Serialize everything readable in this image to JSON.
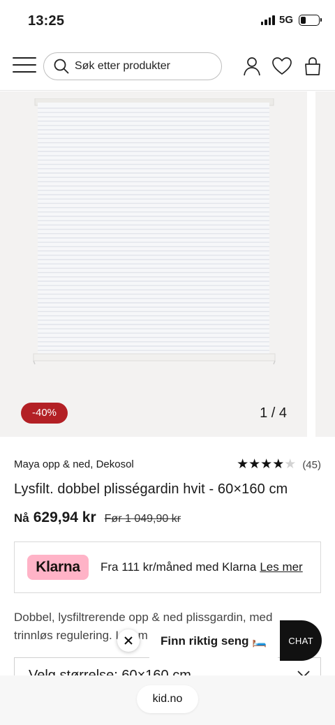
{
  "status_bar": {
    "time": "13:25",
    "network": "5G",
    "battery_level": 0.3
  },
  "header": {
    "search": {
      "placeholder": "Søk etter produkter"
    },
    "icons": [
      "menu-icon",
      "search-icon",
      "user-icon",
      "heart-icon",
      "bag-icon"
    ]
  },
  "gallery": {
    "discount_badge": "-40%",
    "counter": "1 / 4"
  },
  "product": {
    "brand_line": "Maya opp & ned, Dekosol",
    "rating": 4,
    "rating_max": 5,
    "review_count": "(45)",
    "title": "Lysfilt. dobbel plisségardin hvit - 60×160 cm",
    "price_label": "Nå",
    "price_now": "629,94 kr",
    "price_before": "Før 1 049,90 kr",
    "description": "Dobbel, lysfiltrerende opp & ned plissgardin, med trinnløs regulering. Les m"
  },
  "klarna": {
    "logo_text": "Klarna",
    "text": "Fra 111 kr/måned med Klarna",
    "link": "Les mer",
    "brand_color": "#ffb3c7"
  },
  "size_select": {
    "label": "Velg størrelse: 60×160 cm"
  },
  "floating": {
    "bed_finder": "Finn riktig seng 🛏️",
    "chat": "CHAT"
  },
  "browser": {
    "url": "kid.no"
  },
  "colors": {
    "discount": "#b32025",
    "chat_bg": "#111111"
  }
}
